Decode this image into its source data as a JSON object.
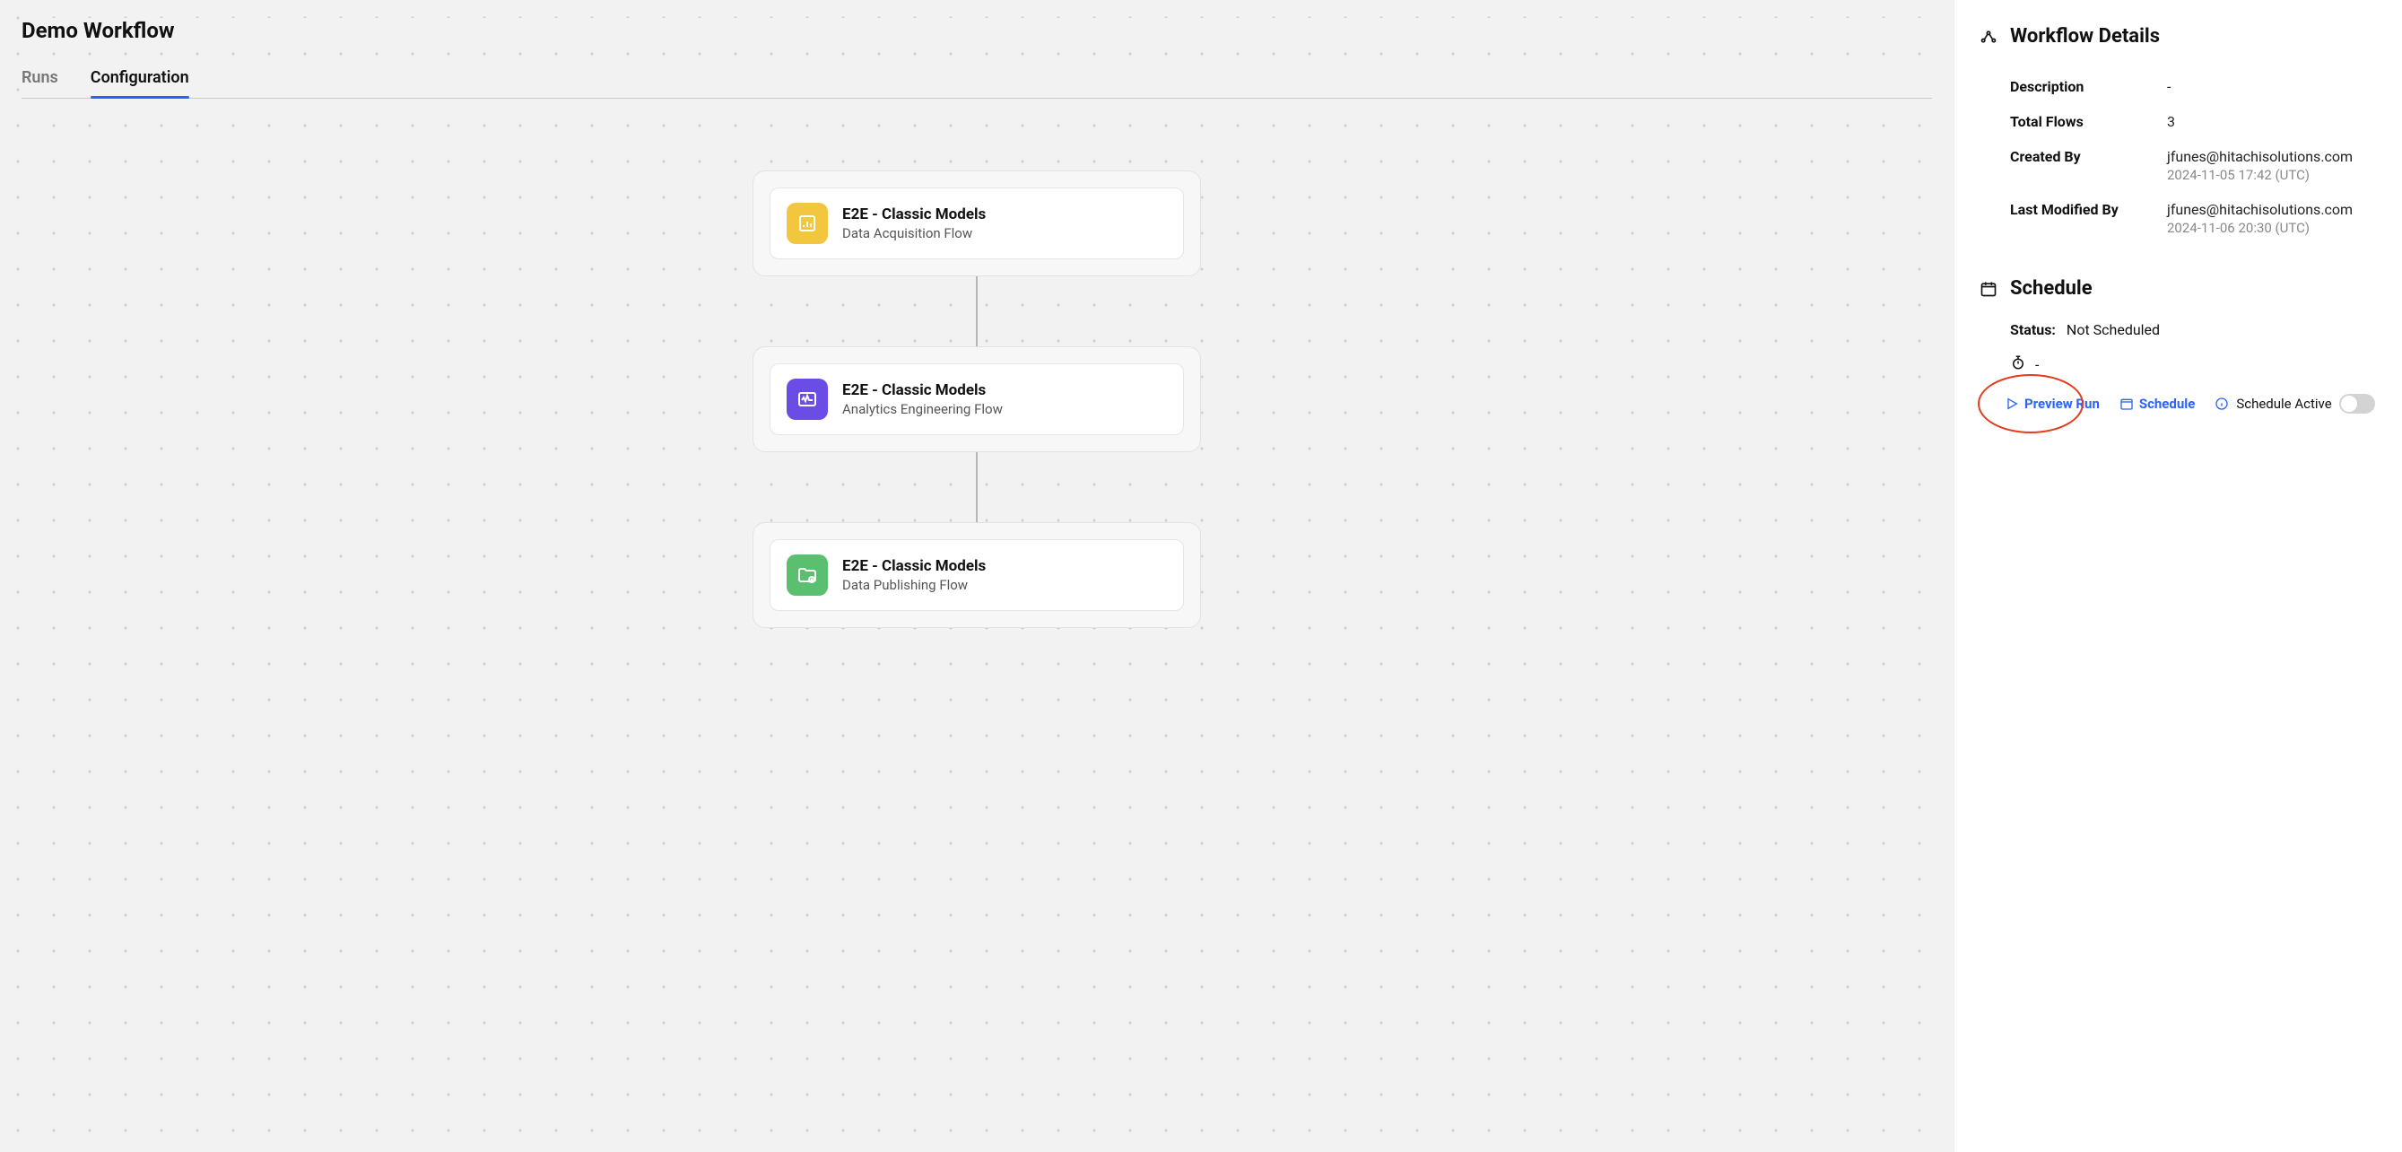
{
  "header": {
    "title": "Demo Workflow",
    "tabs": [
      {
        "label": "Runs",
        "active": false
      },
      {
        "label": "Configuration",
        "active": true
      }
    ]
  },
  "flows": [
    {
      "title": "E2E - Classic Models",
      "subtitle": "Data Acquisition Flow",
      "icon": "chart-icon",
      "color": "ic-yellow"
    },
    {
      "title": "E2E - Classic Models",
      "subtitle": "Analytics Engineering Flow",
      "icon": "pulse-icon",
      "color": "ic-purple"
    },
    {
      "title": "E2E - Classic Models",
      "subtitle": "Data Publishing Flow",
      "icon": "folder-icon",
      "color": "ic-green"
    }
  ],
  "details": {
    "section_title": "Workflow Details",
    "rows": {
      "description": {
        "label": "Description",
        "value": "-"
      },
      "total_flows": {
        "label": "Total Flows",
        "value": "3"
      },
      "created_by": {
        "label": "Created By",
        "value": "jfunes@hitachisolutions.com",
        "sub": "2024-11-05 17:42 (UTC)"
      },
      "modified_by": {
        "label": "Last Modified By",
        "value": "jfunes@hitachisolutions.com",
        "sub": "2024-11-06 20:30 (UTC)"
      }
    }
  },
  "schedule": {
    "section_title": "Schedule",
    "status_label": "Status:",
    "status_value": "Not Scheduled",
    "timer_value": "-",
    "preview_run_label": "Preview Run",
    "schedule_label": "Schedule",
    "schedule_active_label": "Schedule Active",
    "schedule_active_value": false
  }
}
